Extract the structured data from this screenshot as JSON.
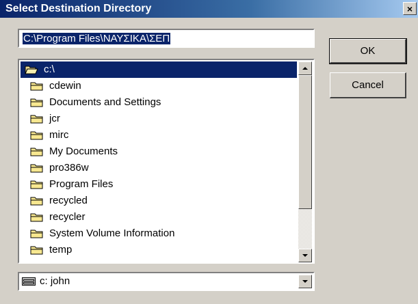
{
  "window": {
    "title": "Select Destination Directory",
    "close_glyph": "×"
  },
  "path_field": {
    "value": "C:\\Program Files\\ΝΑΥΣΙΚΑ\\ΣΕΠ"
  },
  "buttons": {
    "ok_label": "OK",
    "cancel_label": "Cancel"
  },
  "directory_list": {
    "items": [
      {
        "label": "c:\\",
        "icon": "open-folder-icon",
        "selected": true
      },
      {
        "label": "cdewin",
        "icon": "folder-icon"
      },
      {
        "label": "Documents and Settings",
        "icon": "folder-icon"
      },
      {
        "label": "jcr",
        "icon": "folder-icon"
      },
      {
        "label": "mirc",
        "icon": "folder-icon"
      },
      {
        "label": "My Documents",
        "icon": "folder-icon"
      },
      {
        "label": "pro386w",
        "icon": "folder-icon"
      },
      {
        "label": "Program Files",
        "icon": "folder-icon"
      },
      {
        "label": "recycled",
        "icon": "folder-icon"
      },
      {
        "label": "recycler",
        "icon": "folder-icon"
      },
      {
        "label": "System Volume Information",
        "icon": "folder-icon"
      },
      {
        "label": "temp",
        "icon": "folder-icon"
      }
    ]
  },
  "drive_combo": {
    "value": "c:  john",
    "icon": "drive-icon"
  },
  "colors": {
    "title_bar": "#0a246a",
    "selection": "#0a246a",
    "face": "#d4d0c8"
  }
}
